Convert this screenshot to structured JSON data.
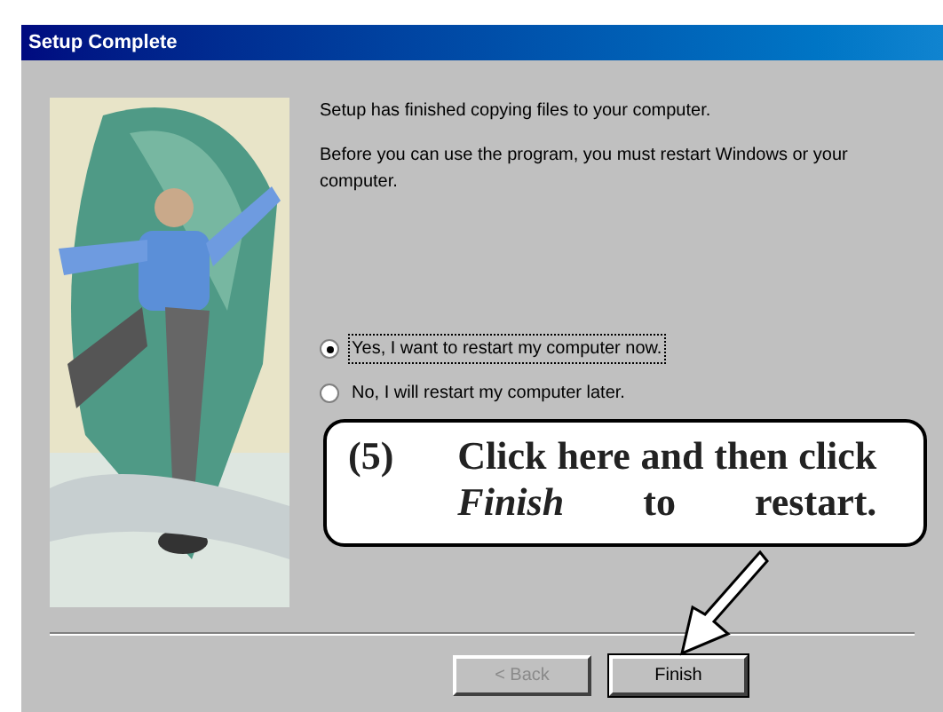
{
  "window": {
    "title": "Setup Complete"
  },
  "messages": [
    "Setup has finished copying files to your computer.",
    "Before you can use the program, you must restart Windows or your computer."
  ],
  "options": [
    {
      "label": "Yes, I want to restart my computer now.",
      "selected": true
    },
    {
      "label": "No, I will restart my computer later.",
      "selected": false
    }
  ],
  "callout": {
    "step": "(5)",
    "text": "Click here and then click *Finish* to restart."
  },
  "buttons": [
    {
      "label": "< Back",
      "disabled": true
    },
    {
      "label": "Finish",
      "disabled": false
    }
  ]
}
